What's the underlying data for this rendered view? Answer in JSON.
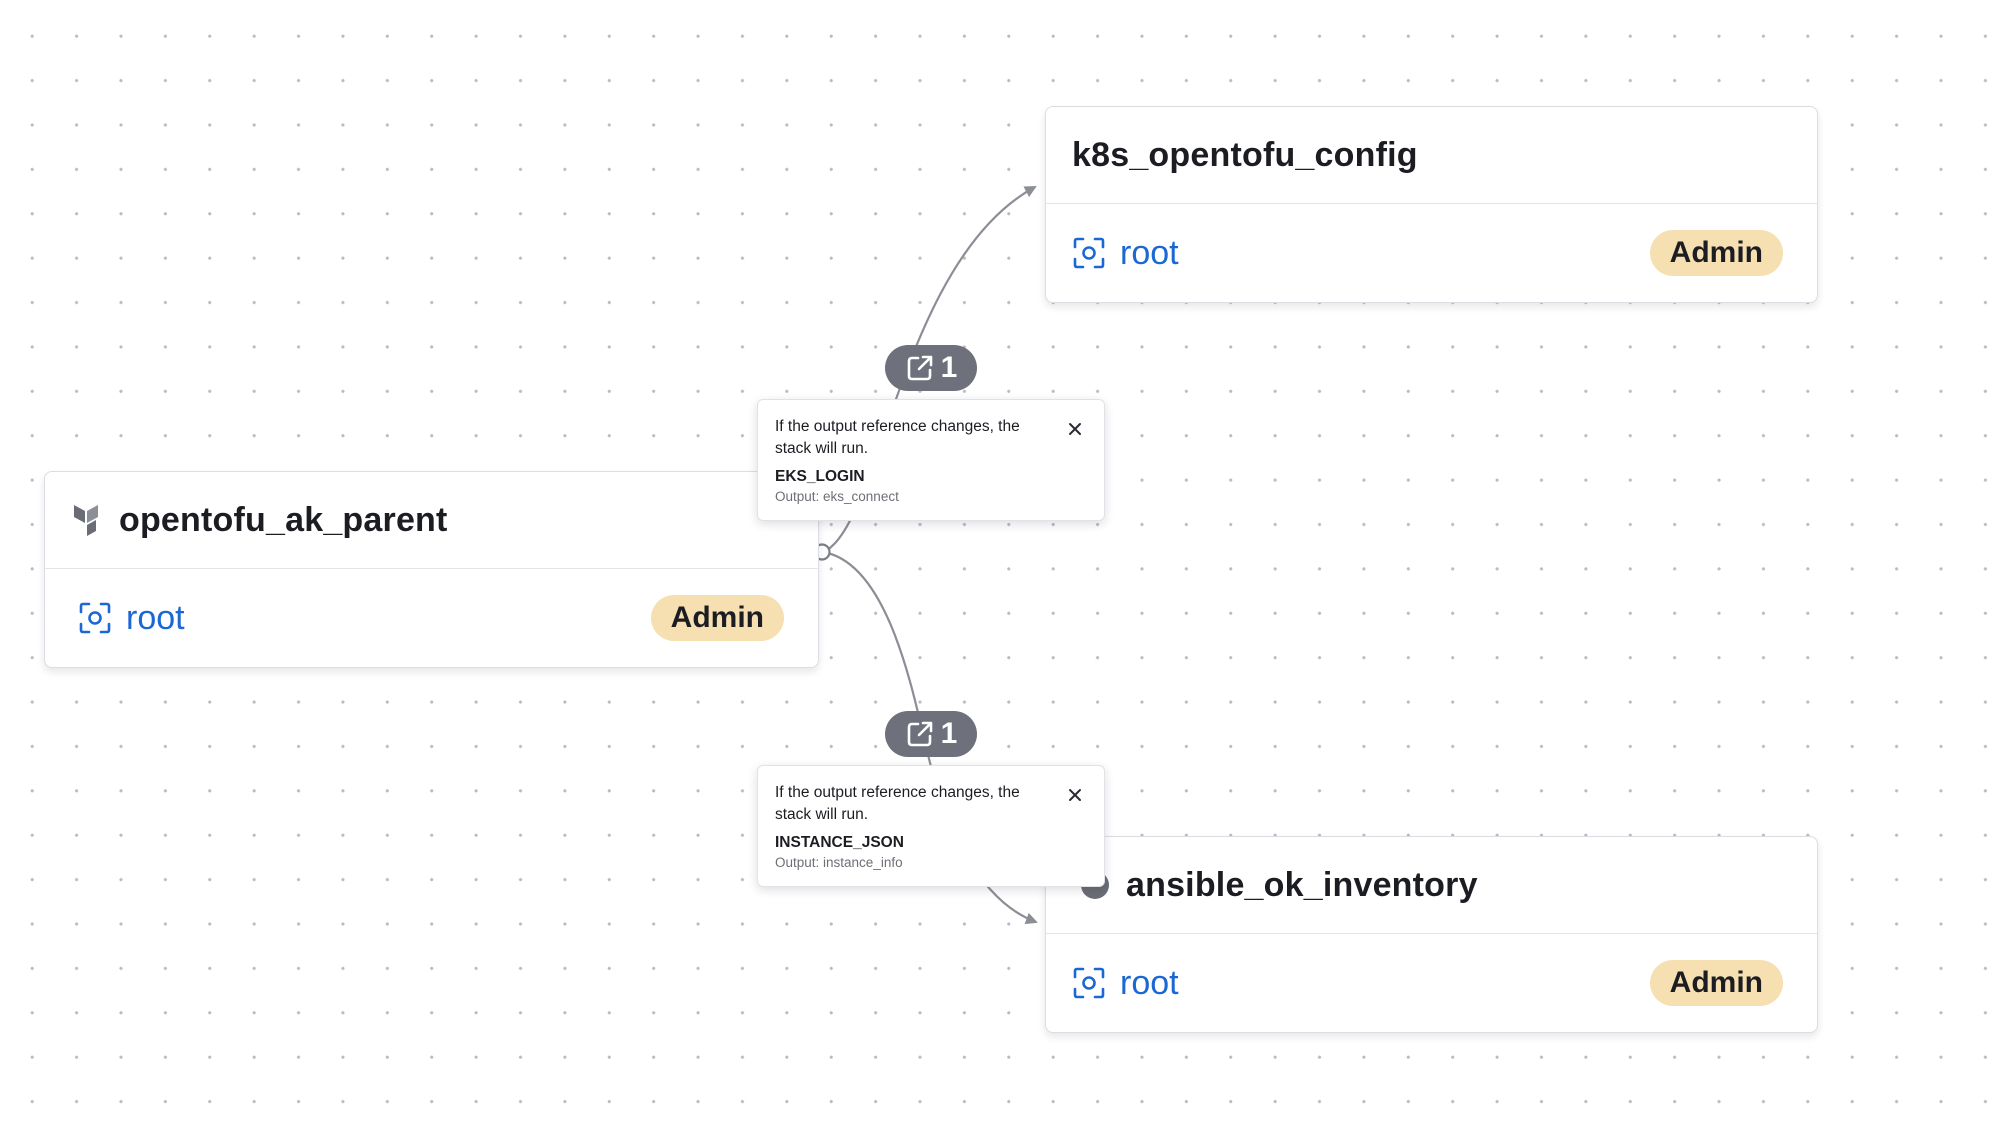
{
  "nodes": {
    "k8s": {
      "title": "k8s_opentofu_config",
      "space": "root",
      "role": "Admin"
    },
    "parent": {
      "title": "opentofu_ak_parent",
      "space": "root",
      "role": "Admin",
      "type_icon": "terraform-icon"
    },
    "ansible": {
      "title": "ansible_ok_inventory",
      "space": "root",
      "role": "Admin"
    }
  },
  "references": [
    {
      "count": "1",
      "description": "If the output reference changes, the stack will run.",
      "reference_name": "EKS_LOGIN",
      "output": "Output: eks_connect"
    },
    {
      "count": "1",
      "description": "If the output reference changes, the stack will run.",
      "reference_name": "INSTANCE_JSON",
      "output": "Output: instance_info"
    }
  ],
  "colors": {
    "space_link": "#1b67d4",
    "badge_bg": "#f6dfb0",
    "pill_bg": "#6e707c",
    "edge": "#8c8e96"
  },
  "icons": {
    "space": "space-icon",
    "reference": "external-link-icon",
    "close": "close-icon"
  }
}
